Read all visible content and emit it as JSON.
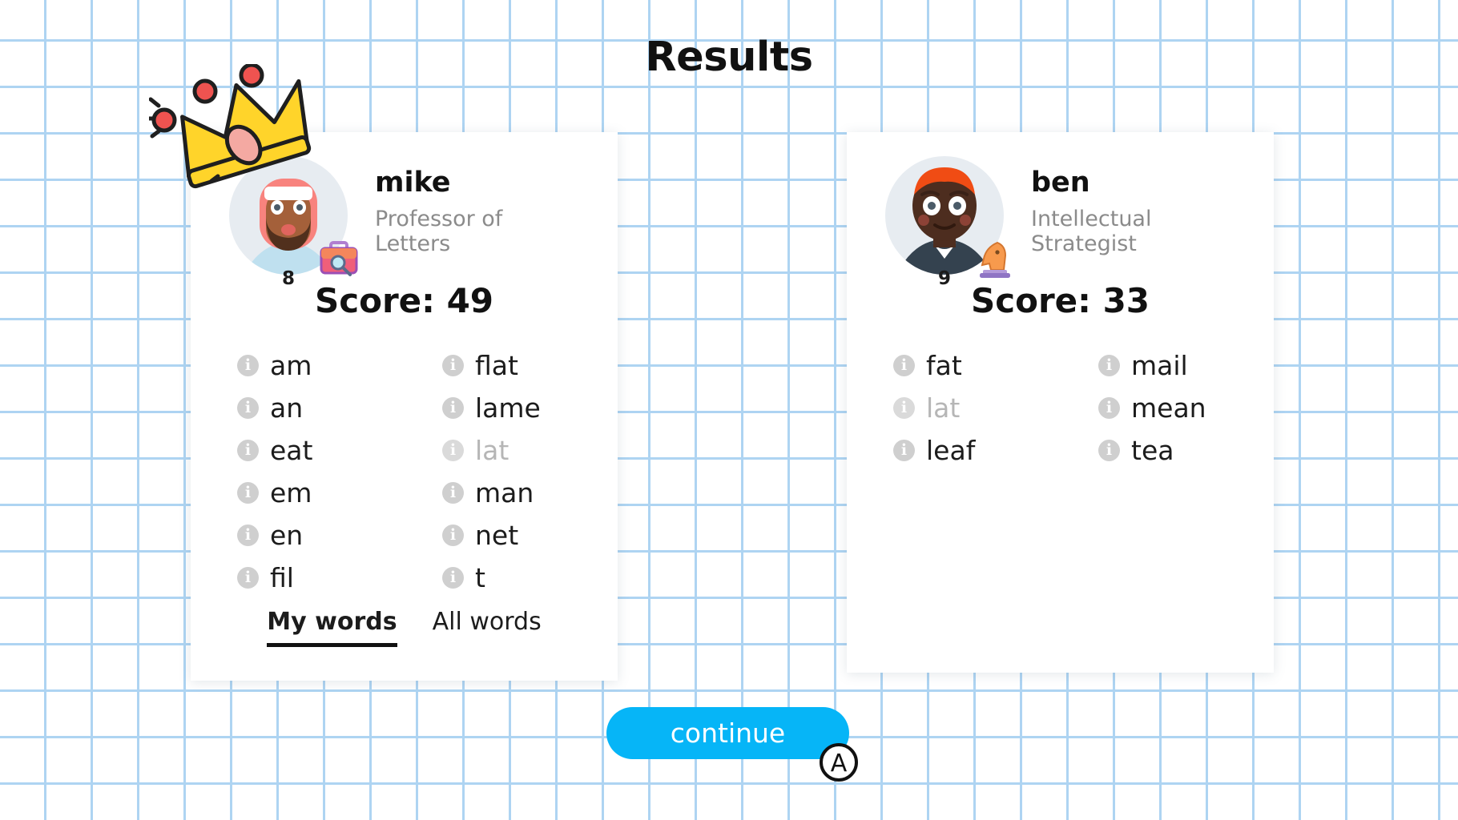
{
  "page": {
    "title": "Results",
    "background": "graph-paper",
    "grid_color": "#aed4f2"
  },
  "players": [
    {
      "name": "mike",
      "role": "Professor of Letters",
      "badge_number": "8",
      "score_label": "Score: 49",
      "score": 49,
      "winner": true,
      "emblem": "briefcase-icon",
      "avatar": {
        "hair_color": "#f8837e",
        "skin_color": "#a4603a",
        "shirt_color": "#bfe0ef",
        "background": "#e7ecf1"
      },
      "word_columns": [
        [
          {
            "word": "am",
            "dim": false
          },
          {
            "word": "an",
            "dim": false
          },
          {
            "word": "eat",
            "dim": false
          },
          {
            "word": "em",
            "dim": false
          },
          {
            "word": "en",
            "dim": false
          },
          {
            "word": "fil",
            "dim": false
          }
        ],
        [
          {
            "word": "flat",
            "dim": false
          },
          {
            "word": "lame",
            "dim": false
          },
          {
            "word": "lat",
            "dim": true
          },
          {
            "word": "man",
            "dim": false
          },
          {
            "word": "net",
            "dim": false
          },
          {
            "word": "t",
            "dim": false
          }
        ]
      ],
      "tabs": [
        {
          "label": "My words",
          "active": true
        },
        {
          "label": "All words",
          "active": false
        }
      ]
    },
    {
      "name": "ben",
      "role": "Intellectual Strategist",
      "badge_number": "9",
      "score_label": "Score: 33",
      "score": 33,
      "winner": false,
      "emblem": "chess-knight-icon",
      "avatar": {
        "hair_color": "#f04c14",
        "skin_color": "#4d2d1f",
        "shirt_color": "#34424f",
        "background": "#e7ecf1"
      },
      "word_columns": [
        [
          {
            "word": "fat",
            "dim": false
          },
          {
            "word": "lat",
            "dim": true
          },
          {
            "word": "leaf",
            "dim": false
          }
        ],
        [
          {
            "word": "mail",
            "dim": false
          },
          {
            "word": "mean",
            "dim": false
          },
          {
            "word": "tea",
            "dim": false
          }
        ]
      ],
      "tabs": []
    }
  ],
  "footer": {
    "continue_label": "continue",
    "continue_color": "#06b5f7",
    "button_hint": "A"
  }
}
